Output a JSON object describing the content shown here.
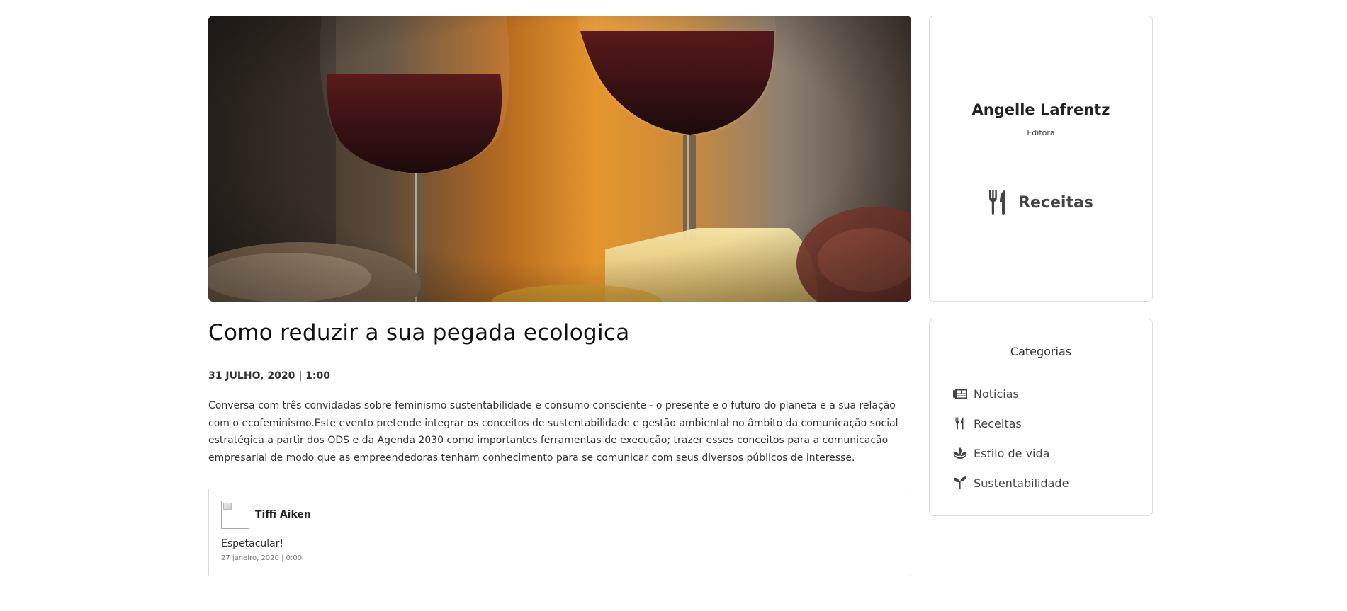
{
  "post": {
    "title": "Como reduzir a sua pegada ecologica",
    "date": "31 JULHO, 2020 | 1:00",
    "body": "Conversa com três convidadas sobre feminismo sustentabilidade e consumo consciente - o presente e o futuro do planeta e a sua relação com o ecofeminismo.Este evento pretende integrar os conceitos de sustentabilidade e gestão ambiental no âmbito da comunicação social estratégica a partir dos ODS e da Agenda 2030 como importantes ferramentas de execução; trazer esses conceitos para a comunicação empresarial de modo que as empreendedoras tenham conhecimento para se comunicar com seus diversos públicos de interesse.",
    "image_icon": "wine-glasses-photo"
  },
  "comment": {
    "author": "Tiffi Aiken",
    "text": "Espetacular!",
    "time": "27 janeiro, 2020 | 0:00",
    "avatar_icon": "broken-image-icon"
  },
  "author_card": {
    "name": "Angelle Lafrentz",
    "role": "Editora",
    "category": "Receitas",
    "category_icon": "utensils-icon"
  },
  "categories": {
    "heading": "Categorias",
    "items": [
      {
        "label": "Notícias",
        "icon": "newspaper-icon"
      },
      {
        "label": "Receitas",
        "icon": "utensils-icon"
      },
      {
        "label": "Estilo de vida",
        "icon": "spa-icon"
      },
      {
        "label": "Sustentabilidade",
        "icon": "seedling-icon"
      }
    ]
  },
  "colors": {
    "text": "#333333",
    "border": "#dddddd",
    "icon": "#444444"
  }
}
